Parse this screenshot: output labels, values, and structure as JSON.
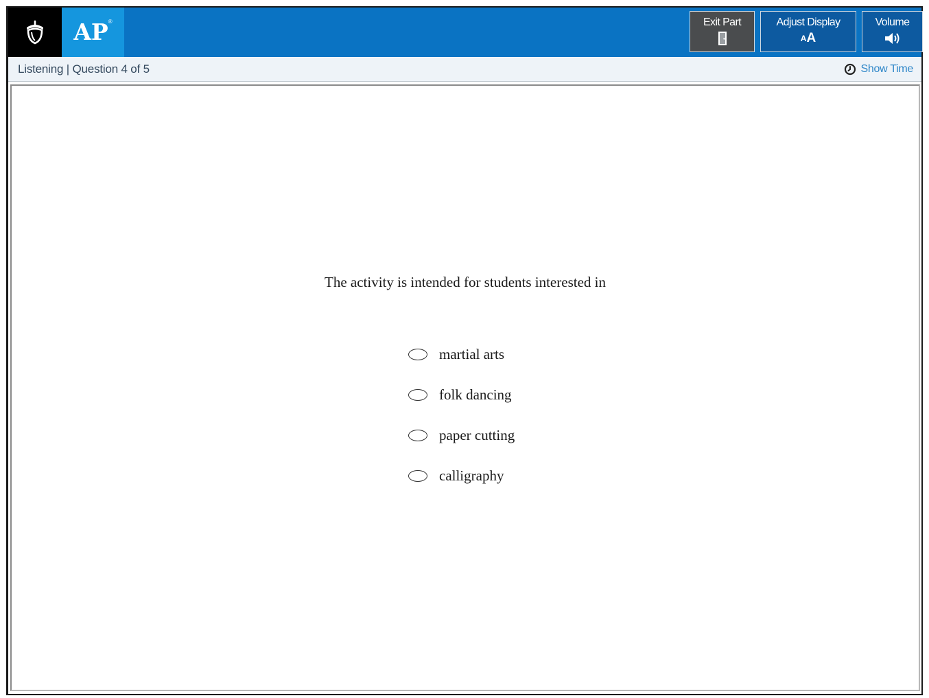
{
  "header": {
    "brand_text": "AP",
    "brand_mark": "®",
    "exit_label": "Exit Part",
    "display_label": "Adjust Display",
    "display_icon_small": "A",
    "display_icon_big": "A",
    "volume_label": "Volume",
    "icons": {
      "seal": "college-board-acorn-icon",
      "exit": "door-exit-icon",
      "display": "text-size-icon",
      "volume": "speaker-icon"
    },
    "colors": {
      "bar": "#0a73c3",
      "ap_tile": "#1596de",
      "exit_button": "#4a4c4e",
      "tool_button": "#0d5aa0"
    }
  },
  "subheader": {
    "section": "Listening",
    "separator": "|",
    "question_progress": "Question 4 of 5",
    "show_time_label": "Show Time",
    "show_time_icon": "clock-icon"
  },
  "question": {
    "stem": "The activity is intended for students interested in",
    "options": [
      {
        "label": "martial arts",
        "selected": false
      },
      {
        "label": "folk dancing",
        "selected": false
      },
      {
        "label": "paper cutting",
        "selected": false
      },
      {
        "label": "calligraphy",
        "selected": false
      }
    ]
  }
}
